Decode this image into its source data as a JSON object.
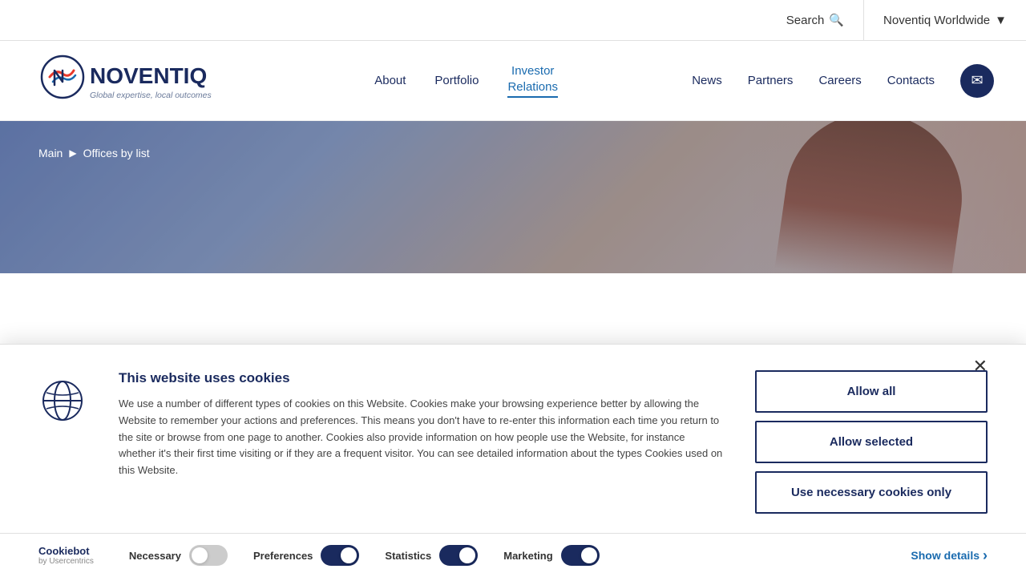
{
  "topbar": {
    "search_label": "Search",
    "region_label": "Noventiq Worldwide",
    "search_icon": "🔍",
    "chevron_icon": "▼"
  },
  "nav": {
    "logo_alt": "Noventiq",
    "tagline": "Global expertise, local outcomes",
    "links": [
      {
        "id": "about",
        "label": "About",
        "active": false
      },
      {
        "id": "portfolio",
        "label": "Portfolio",
        "active": false
      },
      {
        "id": "investor-relations",
        "label": "Investor Relations",
        "active": true
      }
    ],
    "right_links": [
      {
        "id": "news",
        "label": "News"
      },
      {
        "id": "partners",
        "label": "Partners"
      },
      {
        "id": "careers",
        "label": "Careers"
      },
      {
        "id": "contacts",
        "label": "Contacts"
      }
    ],
    "email_icon": "✉"
  },
  "breadcrumb": {
    "main": "Main",
    "separator": "▶",
    "current": "Offices by list"
  },
  "cookie": {
    "title": "This website uses cookies",
    "body": "We use a number of different types of cookies on this Website. Cookies make your browsing experience better by allowing the Website to remember your actions and preferences. This means you don't have to re-enter this information each time you return to the site or browse from one page to another. Cookies also provide information on how people use the Website, for instance whether it's their first time visiting or if they are a frequent visitor. You can see detailed information about the types Cookies used on this Website.",
    "btn_allow_all": "Allow all",
    "btn_allow_selected": "Allow selected",
    "btn_necessary_only": "Use necessary cookies only",
    "close_icon": "✕",
    "globe_icon": "🌐",
    "footer": {
      "brand": "Cookiebot",
      "by_line": "by Usercentrics",
      "toggles": [
        {
          "label": "Necessary",
          "on": false
        },
        {
          "label": "Preferences",
          "on": true
        },
        {
          "label": "Statistics",
          "on": true
        },
        {
          "label": "Marketing",
          "on": true
        }
      ],
      "show_details": "Show details",
      "chevron": "›"
    }
  }
}
